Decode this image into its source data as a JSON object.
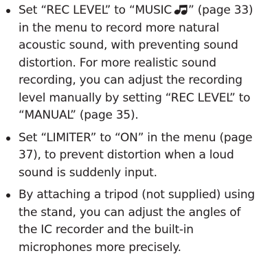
{
  "items": [
    {
      "text_before_icon": "Set “REC LEVEL” to “MUSIC",
      "icon": "music-note-icon",
      "text_after_icon": "” (page 33) in the menu to record more natural acoustic sound, with preventing  sound distortion. For more realistic sound recording, you can adjust the recording level manually by setting “REC LEVEL” to “MANUAL” (page 35)."
    },
    {
      "text": "Set “LIMITER” to “ON” in the menu (page 37), to prevent distortion when a loud sound is suddenly input."
    },
    {
      "text": "By attaching a tripod (not supplied) using the stand, you can adjust the angles of the IC recorder and the built-in microphones more precisely."
    }
  ]
}
